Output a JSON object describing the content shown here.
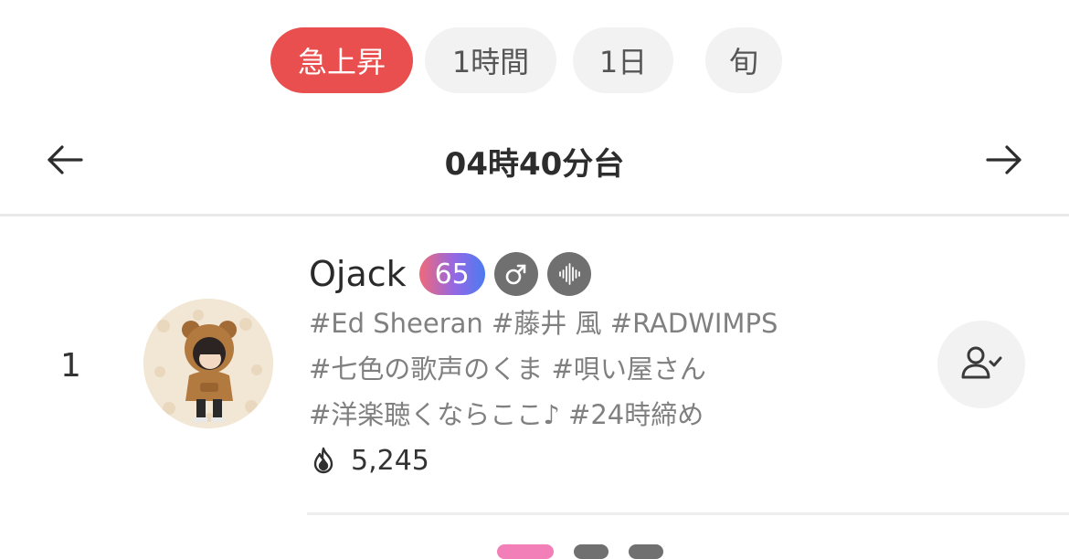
{
  "tabs": [
    {
      "label": "急上昇",
      "active": true
    },
    {
      "label": "1時間",
      "active": false
    },
    {
      "label": "1日",
      "active": false
    },
    {
      "label": "旬",
      "active": false
    }
  ],
  "time_nav": {
    "label": "04時40分台",
    "prev_icon": "arrow-left-icon",
    "next_icon": "arrow-right-icon"
  },
  "ranking": [
    {
      "rank": "1",
      "username": "Ojack",
      "level": "65",
      "gender_icon": "male-icon",
      "audio_icon": "waveform-icon",
      "tags": [
        [
          "#Ed Sheeran",
          "#藤井 風",
          "#RADWIMPS"
        ],
        [
          "#七色の歌声のくま",
          "#唄い屋さん"
        ],
        [
          "#洋楽聴くならここ♪",
          "#24時締め"
        ]
      ],
      "count_icon": "flame-icon",
      "count": "5,245",
      "follow_icon": "follow-user-check-icon"
    }
  ],
  "colors": {
    "accent": "#ea4f4f",
    "tab_bg": "#f2f2f2",
    "tag_text": "#808080",
    "badge_gradient": [
      "#f0697a",
      "#9168e6",
      "#4c7cf0"
    ],
    "icon_gray": "#707070"
  }
}
